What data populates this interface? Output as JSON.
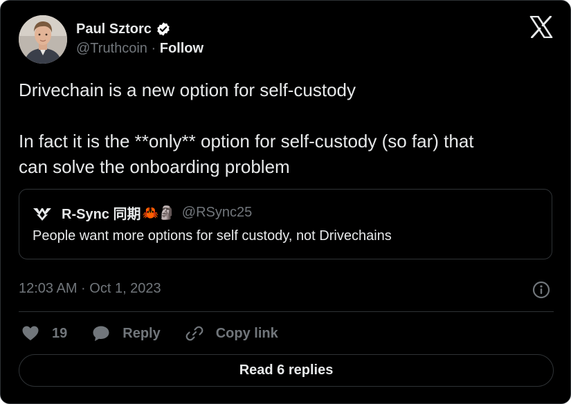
{
  "author": {
    "name": "Paul Sztorc",
    "handle": "@Truthcoin",
    "separator": "·",
    "follow_label": "Follow",
    "verified_icon": "verified-badge-icon"
  },
  "brand": {
    "logo_icon": "x-logo-icon"
  },
  "tweet": {
    "lines": [
      "Drivechain is a new option for self-custody",
      "In fact it is the **only** option for self-custody (so far) that",
      "can solve the onboarding problem"
    ]
  },
  "quote": {
    "name": "R-Sync 同期",
    "emoji": "🦀🗿",
    "handle": "@RSync25",
    "text": "People want more options for self custody, not Drivechains"
  },
  "meta": {
    "timestamp": "12:03 AM · Oct 1, 2023",
    "info_icon": "info-icon"
  },
  "actions": {
    "like_count": "19",
    "reply_label": "Reply",
    "copy_link_label": "Copy link"
  },
  "footer": {
    "read_replies_label": "Read 6 replies"
  },
  "colors": {
    "background": "#000000",
    "text_primary": "#e7e9ea",
    "text_secondary": "#71767b",
    "border": "#2f3336"
  }
}
